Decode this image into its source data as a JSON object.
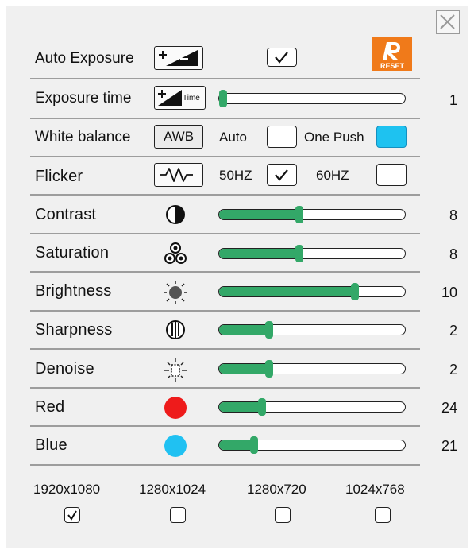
{
  "rows": {
    "auto_exposure": {
      "label": "Auto Exposure",
      "checked": true
    },
    "exposure_time": {
      "label": "Exposure time",
      "value": "1",
      "icon_text": "Time",
      "level": 0.02
    },
    "white_balance": {
      "label": "White balance",
      "button": "AWB",
      "auto_label": "Auto",
      "one_push_label": "One Push"
    },
    "flicker": {
      "label": "Flicker",
      "hz50_label": "50HZ",
      "hz60_label": "60HZ",
      "hz50_checked": true
    },
    "contrast": {
      "label": "Contrast",
      "value": "8",
      "level": 0.43
    },
    "saturation": {
      "label": "Saturation",
      "value": "8",
      "level": 0.43
    },
    "brightness": {
      "label": "Brightness",
      "value": "10",
      "level": 0.73
    },
    "sharpness": {
      "label": "Sharpness",
      "value": "2",
      "level": 0.27
    },
    "denoise": {
      "label": "Denoise",
      "value": "2",
      "level": 0.27
    },
    "red": {
      "label": "Red",
      "value": "24",
      "level": 0.23
    },
    "blue": {
      "label": "Blue",
      "value": "21",
      "level": 0.19
    }
  },
  "reset": {
    "label": "RESET",
    "color": "#f07a1a"
  },
  "resolutions": [
    {
      "label": "1920x1080",
      "checked": true
    },
    {
      "label": "1280x1024",
      "checked": false
    },
    {
      "label": "1280x720",
      "checked": false
    },
    {
      "label": "1024x768",
      "checked": false
    }
  ],
  "colors": {
    "slider": "#33a868",
    "red_dot": "#ee1b1b",
    "blue_dot": "#20c1f2",
    "one_push_box": "#1ec2f0"
  },
  "icons": [
    "close-icon",
    "exposure-icon",
    "exposure-time-icon",
    "awb-icon",
    "flicker-wave-icon",
    "contrast-icon",
    "saturation-icon",
    "brightness-icon",
    "sharpness-icon",
    "denoise-icon",
    "red-dot-icon",
    "blue-dot-icon"
  ]
}
